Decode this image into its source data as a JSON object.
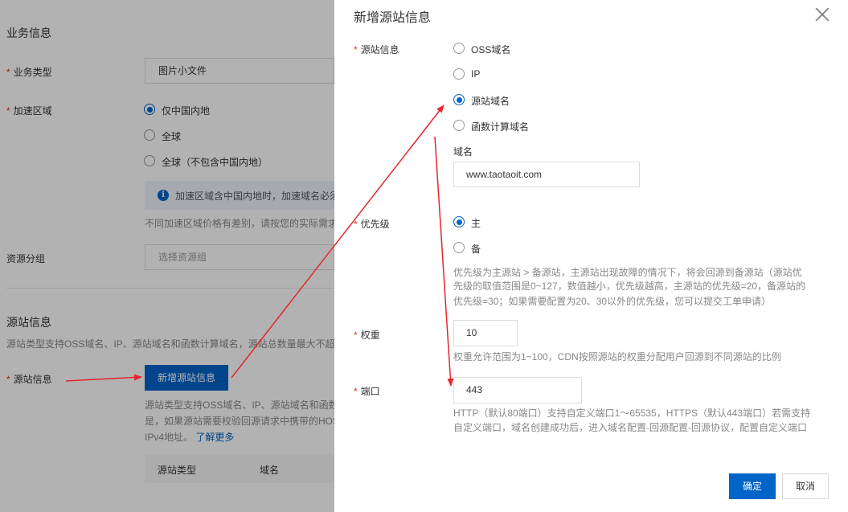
{
  "background": {
    "business_info_title": "业务信息",
    "business_type": {
      "label": "业务类型",
      "value": "图片小文件"
    },
    "accel_region": {
      "label": "加速区域",
      "options": [
        "仅中国内地",
        "全球",
        "全球（不包含中国内地）"
      ],
      "selected_index": 0,
      "info_text": "加速区域含中国内地时，加速域名必须",
      "price_hint": "不同加速区域价格有差别，请按您的实际需求"
    },
    "resource_group": {
      "label": "资源分组",
      "placeholder": "选择资源组"
    },
    "origin_section": {
      "title": "源站信息",
      "desc": "源站类型支持OSS域名、IP、源站域名和函数计算域名，源站总数量最大不超过",
      "label": "源站信息",
      "add_button": "新增源站信息",
      "help_line1": "源站类型支持OSS域名、IP、源站域名和函数",
      "help_line2": "是，如果源站需要校验回源请求中携带的HOS",
      "help_line3": "IPv4地址。",
      "learn_more": "了解更多",
      "table_headers": [
        "源站类型",
        "域名"
      ]
    }
  },
  "dialog": {
    "title": "新增源站信息",
    "origin_info": {
      "label": "源站信息",
      "options": [
        "OSS域名",
        "IP",
        "源站域名",
        "函数计算域名"
      ],
      "selected_index": 2
    },
    "domain": {
      "label": "域名",
      "value": "www.taotaoit.com"
    },
    "priority": {
      "label": "优先级",
      "options": [
        "主",
        "备"
      ],
      "selected_index": 0,
      "hint_lines": [
        "优先级为主源站 > 备源站，主源站出现故障的情况下，将会回源到备源站（源站优",
        "先级的取值范围是0~127，数值越小，优先级越高，主源站的优先级=20，备源站的",
        "优先级=30；如果需要配置为20、30以外的优先级，您可以提交工单申请）"
      ]
    },
    "weight": {
      "label": "权重",
      "value": "10",
      "hint": "权重允许范围为1~100，CDN按照源站的权重分配用户回源到不同源站的比例"
    },
    "port": {
      "label": "端口",
      "value": "443",
      "hint_lines": [
        "HTTP（默认80端口）支持自定义端口1～65535，HTTPS（默认443端口）若需支持",
        "自定义端口，域名创建成功后，进入域名配置-回源配置-回源协议，配置自定义端口"
      ]
    },
    "confirm_label": "确定",
    "cancel_label": "取消"
  },
  "colors": {
    "accent": "#0064c8",
    "required": "#d93026",
    "annotation_arrow": "#e5262b"
  }
}
